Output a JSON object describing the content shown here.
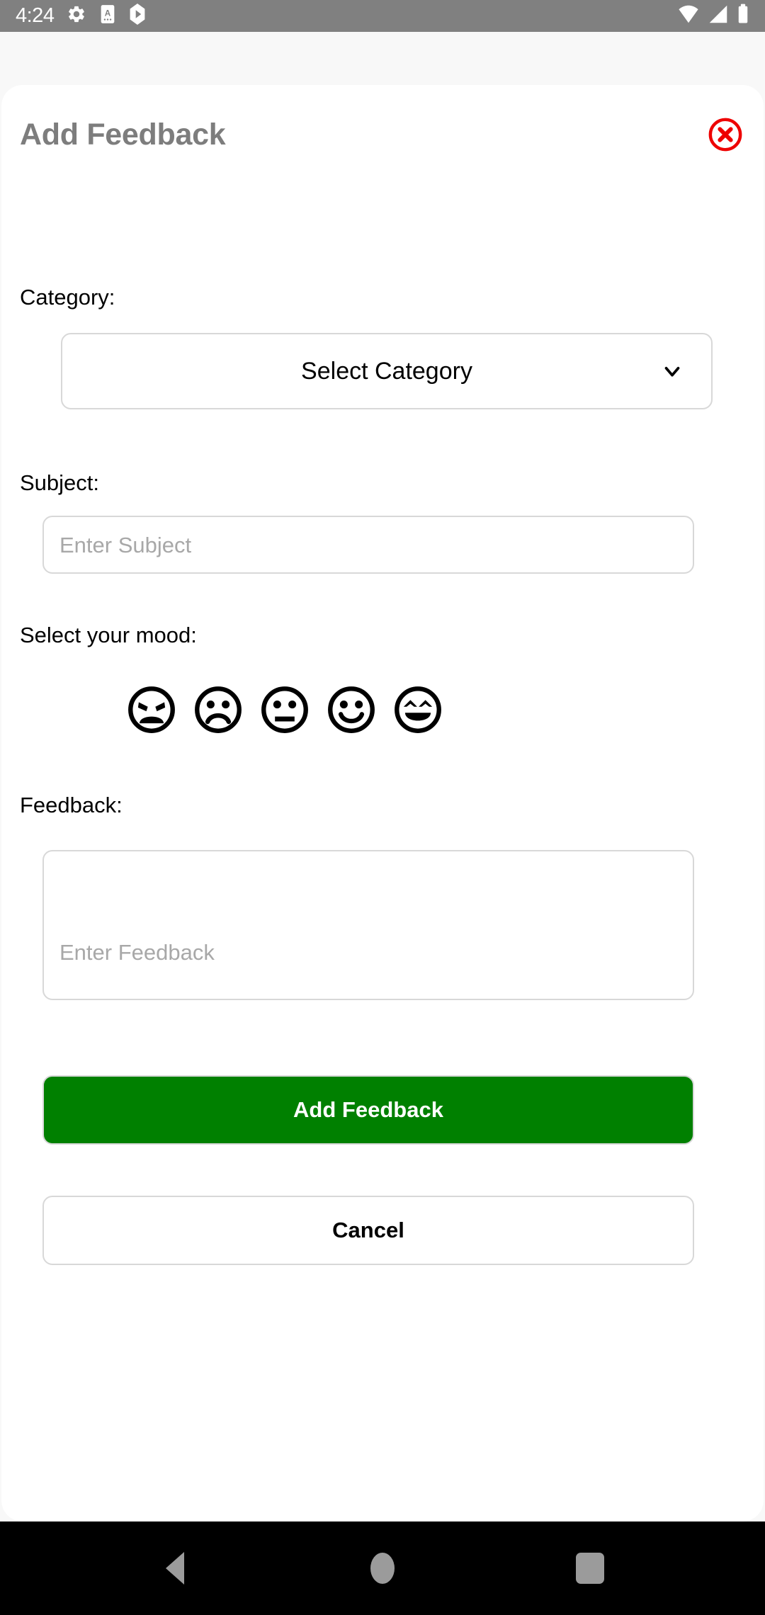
{
  "status_bar": {
    "time": "4:24",
    "left_icons": [
      "gear-icon",
      "assistant-app-icon",
      "play-store-icon"
    ],
    "right_icons": [
      "wifi-icon",
      "cellular-signal-icon",
      "battery-icon"
    ],
    "background_color": "#808080"
  },
  "dialog": {
    "title": "Add Feedback",
    "title_color": "#7d7d7d",
    "close_label": "close",
    "close_color": "#ee0000",
    "category": {
      "label": "Category:",
      "selected": "Select Category",
      "chevron": "chevron-down-icon"
    },
    "subject": {
      "label": "Subject:",
      "value": "",
      "placeholder": "Enter Subject"
    },
    "mood": {
      "label": "Select your mood:",
      "options": [
        {
          "name": "angry",
          "index": 1
        },
        {
          "name": "sad",
          "index": 2
        },
        {
          "name": "neutral",
          "index": 3
        },
        {
          "name": "happy",
          "index": 4
        },
        {
          "name": "very-happy",
          "index": 5
        }
      ],
      "selected": ""
    },
    "feedback": {
      "label": "Feedback:",
      "value": "",
      "placeholder": "Enter Feedback"
    },
    "primary_button": {
      "label": "Add Feedback",
      "color": "#008000",
      "text_color": "#ffffff"
    },
    "secondary_button": {
      "label": "Cancel",
      "color": "#ffffff",
      "text_color": "#000000"
    }
  },
  "nav_bar": {
    "back_label": "Back",
    "home_label": "Home",
    "recents_label": "Recents",
    "background_color": "#000000",
    "icon_color": "#9b9b9b"
  }
}
